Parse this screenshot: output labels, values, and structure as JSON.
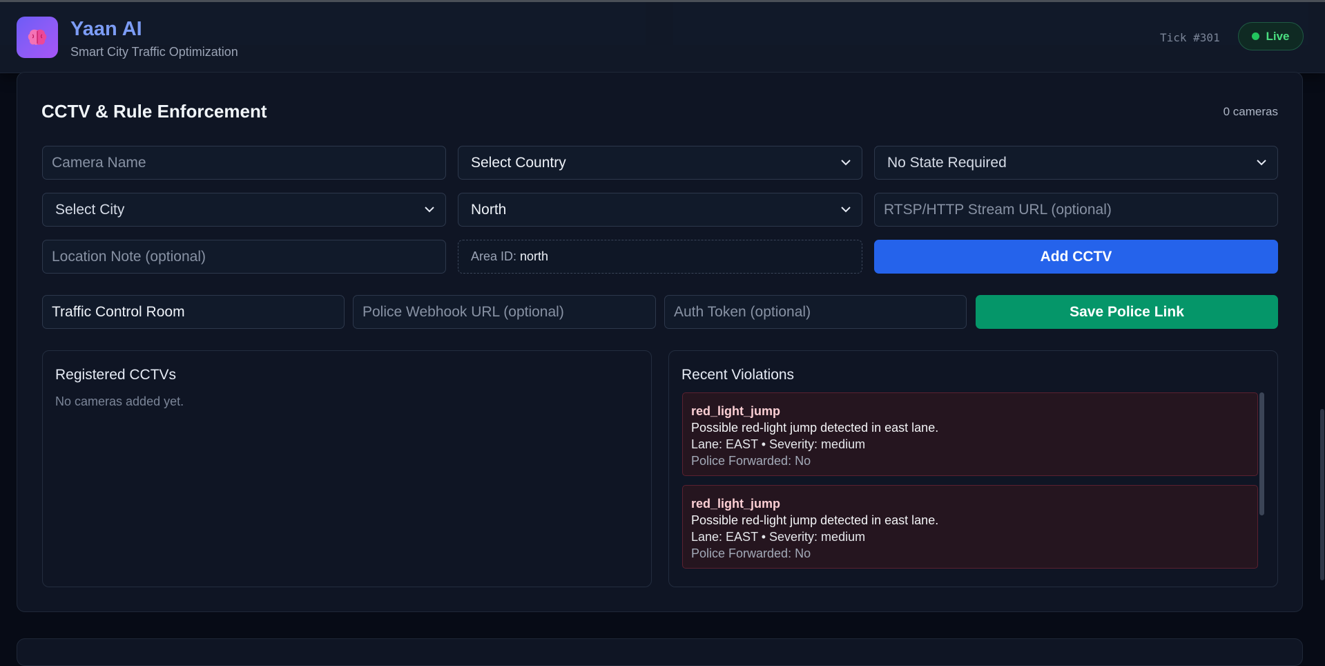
{
  "header": {
    "app_title": "Yaan AI",
    "app_subtitle": "Smart City Traffic Optimization",
    "tick": "Tick #301",
    "live_label": "Live",
    "logo_icon": "brain-icon"
  },
  "cctv": {
    "title": "CCTV & Rule Enforcement",
    "camera_count": "0 cameras",
    "camera_name_placeholder": "Camera Name",
    "country_select": "Select Country",
    "state_select": "No State Required",
    "city_select": "Select City",
    "direction_select": "North",
    "stream_url_placeholder": "RTSP/HTTP Stream URL (optional)",
    "location_note_placeholder": "Location Note (optional)",
    "area_id_label": "Area ID:",
    "area_id_value": "north",
    "add_button": "Add CCTV"
  },
  "police": {
    "room_name_value": "Traffic Control Room",
    "webhook_placeholder": "Police Webhook URL (optional)",
    "auth_token_placeholder": "Auth Token (optional)",
    "save_button": "Save Police Link"
  },
  "registered": {
    "title": "Registered CCTVs",
    "empty_text": "No cameras added yet."
  },
  "violations": {
    "title": "Recent Violations",
    "items": [
      {
        "type": "red_light_jump",
        "message": "Possible red-light jump detected in east lane.",
        "meta": "Lane: EAST • Severity: medium",
        "forwarded": "Police Forwarded: No"
      },
      {
        "type": "red_light_jump",
        "message": "Possible red-light jump detected in east lane.",
        "meta": "Lane: EAST • Severity: medium",
        "forwarded": "Police Forwarded: No"
      }
    ]
  },
  "colors": {
    "background": "#070b16",
    "card": "#0f1524",
    "accent_blue": "#2563eb",
    "accent_green": "#059669",
    "live_green": "#22c55e",
    "violation_bg": "#25151f"
  }
}
